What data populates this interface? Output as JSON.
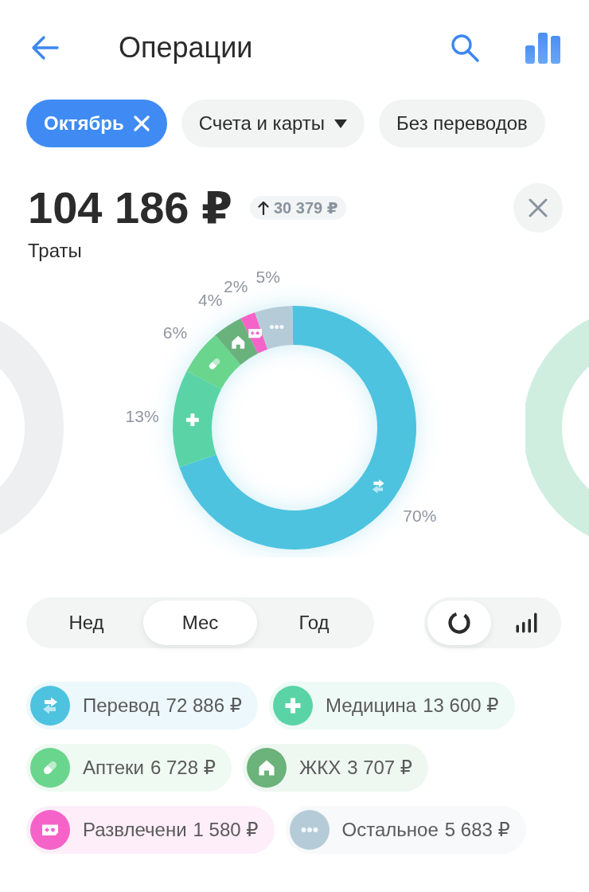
{
  "header": {
    "title": "Операции"
  },
  "filters": [
    {
      "label": "Октябрь",
      "kind": "removable",
      "selected": true
    },
    {
      "label": "Счета и карты",
      "kind": "dropdown",
      "selected": false
    },
    {
      "label": "Без переводов",
      "kind": "plain",
      "selected": false
    }
  ],
  "summary": {
    "amount": "104 186 ₽",
    "change": "30 379 ₽",
    "caption": "Траты"
  },
  "chart": {
    "chart_data": {
      "type": "donut",
      "values": [
        70,
        13,
        6,
        4,
        2,
        5
      ],
      "value_labels": [
        "70%",
        "13%",
        "6%",
        "4%",
        "2%",
        "5%"
      ]
    }
  },
  "period_tabs": [
    {
      "label": "Нед",
      "selected": false
    },
    {
      "label": "Мес",
      "selected": true
    },
    {
      "label": "Год",
      "selected": false
    }
  ],
  "view_toggle": [
    {
      "kind": "donut",
      "selected": true
    },
    {
      "kind": "bars",
      "selected": false
    }
  ],
  "categories": [
    {
      "name": "Перевод",
      "amount": "72 886 ₽",
      "kind": "transfer",
      "color": "#4ec3df"
    },
    {
      "name": "Медицина",
      "amount": "13 600 ₽",
      "kind": "medicine",
      "color": "#5ad4a6"
    },
    {
      "name": "Аптеки",
      "amount": "6 728 ₽",
      "kind": "pharmacy",
      "color": "#6ad58d"
    },
    {
      "name": "ЖКХ",
      "amount": "3 707 ₽",
      "kind": "housing",
      "color": "#6bb27b"
    },
    {
      "name": "Развлечени",
      "amount": "1 580 ₽",
      "kind": "entertainment",
      "color": "#f563c9"
    },
    {
      "name": "Остальное",
      "amount": "5 683 ₽",
      "kind": "other",
      "color": "#b5ccd8"
    }
  ]
}
